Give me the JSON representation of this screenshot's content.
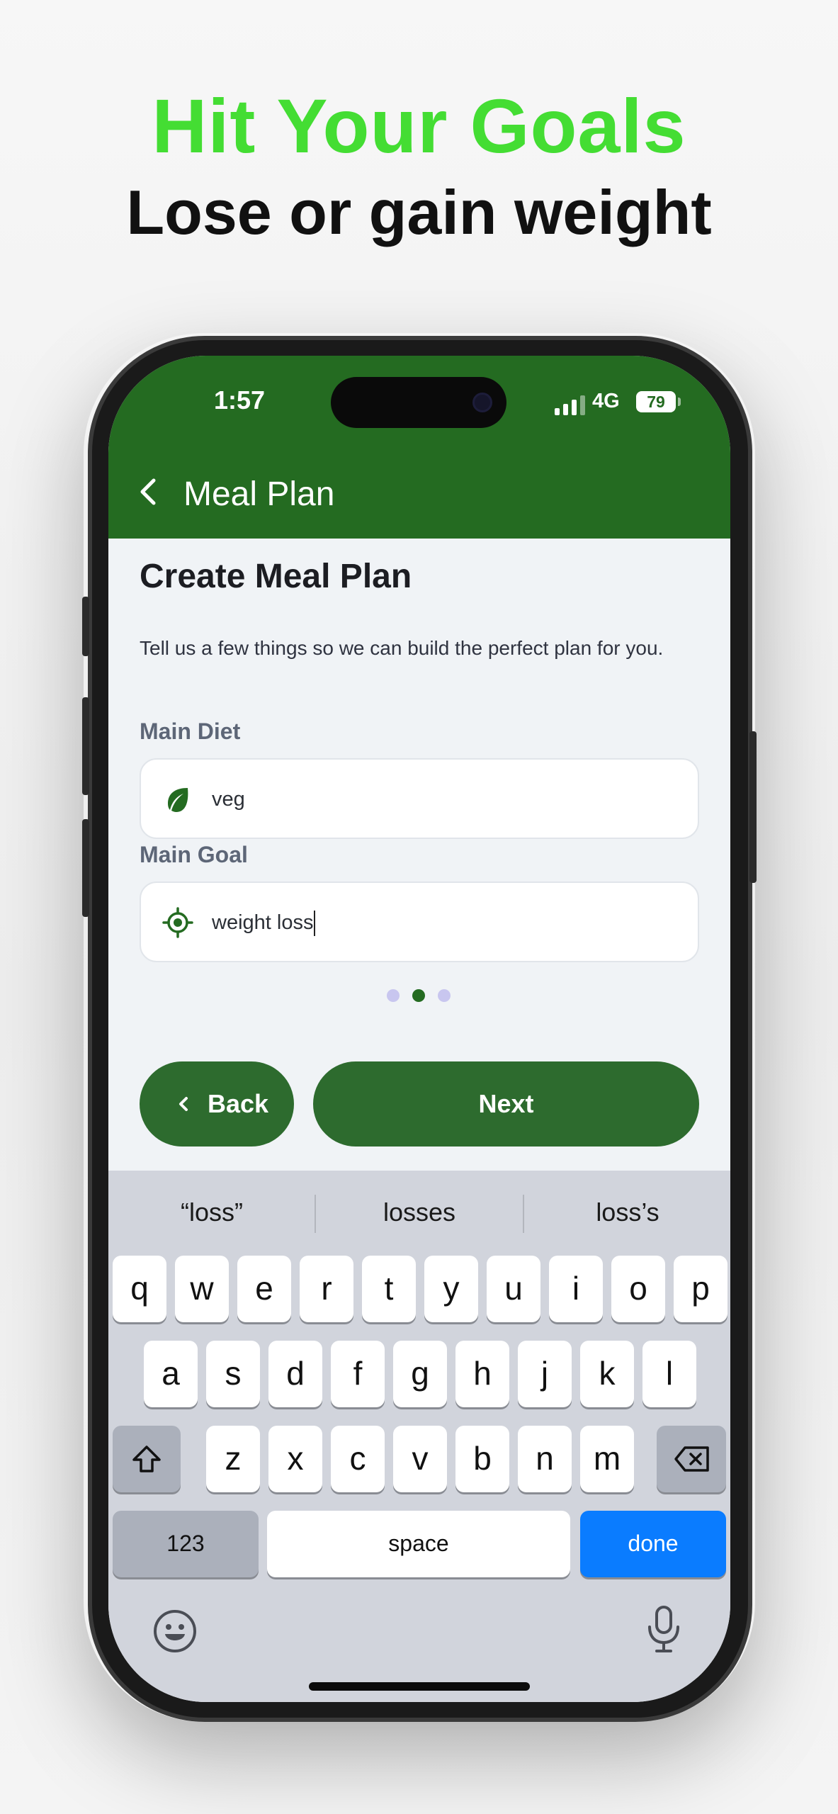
{
  "promo": {
    "headline": "Hit Your Goals",
    "subline": "Lose or gain weight",
    "headline_color": "#44dd33"
  },
  "status_bar": {
    "time": "1:57",
    "network": "4G",
    "battery": "79"
  },
  "app_bar": {
    "title": "Meal Plan",
    "back_icon": "chevron-left-icon",
    "color": "#246b21"
  },
  "form": {
    "title": "Create Meal Plan",
    "description": "Tell us a few things so we can build the perfect plan for you.",
    "fields": [
      {
        "label": "Main Diet",
        "value": "veg",
        "icon": "leaf-icon"
      },
      {
        "label": "Main Goal",
        "value": "weight loss",
        "icon": "target-icon"
      }
    ],
    "pager": {
      "pages": 3,
      "current": 2
    },
    "back_label": "Back",
    "next_label": "Next"
  },
  "keyboard": {
    "suggestions": [
      "“loss”",
      "losses",
      "loss’s"
    ],
    "row1": [
      "q",
      "w",
      "e",
      "r",
      "t",
      "y",
      "u",
      "i",
      "o",
      "p"
    ],
    "row2": [
      "a",
      "s",
      "d",
      "f",
      "g",
      "h",
      "j",
      "k",
      "l"
    ],
    "row3": [
      "z",
      "x",
      "c",
      "v",
      "b",
      "n",
      "m"
    ],
    "numbers_label": "123",
    "space_label": "space",
    "done_label": "done",
    "done_color": "#0a7cff"
  }
}
